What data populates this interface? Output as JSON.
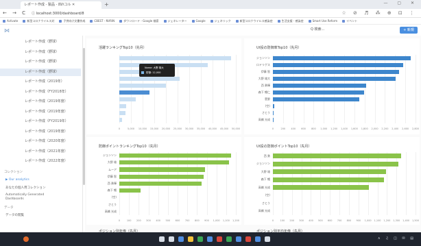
{
  "browser": {
    "tab_title": "レポート作成 - 製品 - 四Λコル ✕",
    "new_tab": "+",
    "window_controls": "— ▢ ✕",
    "nav": "← → C",
    "url": "ⓘ localhost:3000/dashboard/8",
    "toolbar_icons": "☆ ⊘ ♬ ⁂ ⊕ ⊡ ⋮",
    "bookmarks": [
      "Activate",
      "新型コロナウイルス対",
      "子供向け文書作成",
      "CBEST - NVRIN",
      "ダウンロード - Google 検索",
      "ジェネレーター",
      "Google",
      "ジェネリック",
      "新型コロナウイルス感染症",
      "生活支援 - 感染症",
      "Smart Use Reform",
      "イベント"
    ]
  },
  "app": {
    "logo": "⋈",
    "search": "Q 検索...",
    "add_button": "+ 新規"
  },
  "sidebar": {
    "items": [
      {
        "label": "レポート作成（野球）",
        "active": false
      },
      {
        "label": "レポート作成（野球）",
        "active": false
      },
      {
        "label": "レポート作成（野球）",
        "active": false
      },
      {
        "label": "レポート作成（野球）",
        "active": true
      },
      {
        "label": "レポート作成（2019年）",
        "active": false
      },
      {
        "label": "レポート作成（FY2018年）",
        "active": false
      },
      {
        "label": "レポート作成（2019年度）",
        "active": false
      },
      {
        "label": "レポート作成（2019年度）",
        "active": false
      },
      {
        "label": "レポート作成（FY2019年）",
        "active": false
      },
      {
        "label": "レポート作成（2019年度）",
        "active": false
      },
      {
        "label": "レポート作成（2020年度）",
        "active": false
      },
      {
        "label": "レポート作成（2021年度）",
        "active": false
      },
      {
        "label": "レポート作成（2022年度）",
        "active": false
      }
    ],
    "section1": "コレクション",
    "our_analytics": "▶ Our analytics",
    "my_collection": "あなたの個人用コレクション",
    "auto_dash_1": "Automatically Generated",
    "auto_dash_2": "Dashboards",
    "section2": "データ",
    "data_browse": "データの閲覧"
  },
  "charts": {
    "top_left_title": "活躍ランキングTop10（先月）",
    "top_right_title": "Ut投の防御率Top10（先月）",
    "bottom_left_title": "防御ポイントランキングTop10（先月）",
    "bottom_right_title": "Ut投の防御ポイントTop10（先月）",
    "bottom_title_left2": "ポジション別年俸（先月）",
    "bottom_title_right2": "ポジション別平均年俸（先月）",
    "tooltip_line1": "Name: 大野 雄大",
    "tooltip_line2": "防御: 12,000"
  },
  "chart_data": [
    {
      "type": "bar",
      "title": "活躍ランキングTop10（先月）",
      "orientation": "horizontal",
      "categories": [
        "",
        "",
        "",
        "",
        "",
        "",
        "",
        "",
        "",
        ""
      ],
      "values": [
        48000,
        38000,
        22000,
        26000,
        20000,
        13000,
        7000,
        3000,
        2500,
        1200
      ],
      "highlight_index": 5,
      "xticks": [
        "0",
        "5,000",
        "10,000",
        "15,000",
        "20,000",
        "25,000",
        "30,000",
        "35,000",
        "40,000",
        "45,000",
        "50,000"
      ],
      "xlim": [
        0,
        50000
      ],
      "color": "#c9dff3",
      "highlight_color": "#4b8dd2"
    },
    {
      "type": "bar",
      "title": "Ut投の防御率Top10（先月）",
      "orientation": "horizontal",
      "categories": [
        "ジョンソン",
        "ロドリゲス",
        "伊藤 智",
        "大野 雄大",
        "西 勇輝",
        "森下 暢仁",
        "菅野",
        "(空)",
        "さとう",
        "高橋 光成"
      ],
      "values": [
        2800,
        2650,
        2560,
        2500,
        1900,
        1850,
        1750,
        30,
        20,
        15
      ],
      "xticks": [
        "0",
        "200",
        "400",
        "600",
        "800",
        "1,000",
        "1,200",
        "1,400",
        "1,600",
        "1,800",
        "2,000",
        "2,200",
        "2,400",
        "2,600",
        "2,800"
      ],
      "xlim": [
        0,
        2900
      ],
      "color": "#3d86cc"
    },
    {
      "type": "bar",
      "title": "防御ポイントランキングTop10（先月）",
      "orientation": "horizontal",
      "categories": [
        "ジョンソン",
        "大野 雄",
        "ムーア",
        "伊藤 智",
        "西 勇輝",
        "森下 暢",
        "(空)",
        "さとう",
        "高橋 光成"
      ],
      "values": [
        1150,
        1130,
        880,
        870,
        850,
        220,
        0,
        0,
        0
      ],
      "xticks": [
        "0",
        "100",
        "200",
        "300",
        "400",
        "500",
        "600",
        "700",
        "800",
        "900",
        "1,000",
        "1,100",
        "1,200"
      ],
      "xlim": [
        0,
        1200
      ],
      "color": "#8ac34a"
    },
    {
      "type": "bar",
      "title": "Ut投の防御ポイントTop10（先月）",
      "orientation": "horizontal",
      "categories": [
        "西 勇",
        "ジョンソン",
        "大野 雄",
        "森下 暢",
        "高橋 光成",
        "(空)",
        "さとう",
        "高橋 光成"
      ],
      "values": [
        1350,
        1320,
        1190,
        1170,
        1010,
        0,
        0,
        0
      ],
      "xticks": [
        "0",
        "100",
        "200",
        "300",
        "400",
        "500",
        "600",
        "700",
        "800",
        "900",
        "1,000",
        "1,100",
        "1,200",
        "1,300",
        "1,400",
        "1,500"
      ],
      "xlim": [
        0,
        1500
      ],
      "color": "#8ac34a"
    }
  ],
  "taskbar": {
    "tray": "∧ ♫ ◫ ✉ ▤"
  }
}
